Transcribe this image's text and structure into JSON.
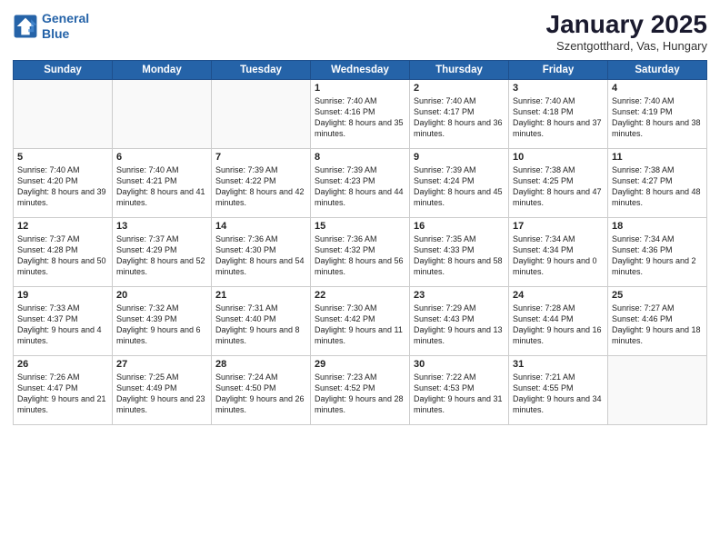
{
  "header": {
    "logo_line1": "General",
    "logo_line2": "Blue",
    "title": "January 2025",
    "subtitle": "Szentgotthard, Vas, Hungary"
  },
  "days": [
    "Sunday",
    "Monday",
    "Tuesday",
    "Wednesday",
    "Thursday",
    "Friday",
    "Saturday"
  ],
  "weeks": [
    [
      {
        "date": "",
        "content": ""
      },
      {
        "date": "",
        "content": ""
      },
      {
        "date": "",
        "content": ""
      },
      {
        "date": "1",
        "content": "Sunrise: 7:40 AM\nSunset: 4:16 PM\nDaylight: 8 hours and 35 minutes."
      },
      {
        "date": "2",
        "content": "Sunrise: 7:40 AM\nSunset: 4:17 PM\nDaylight: 8 hours and 36 minutes."
      },
      {
        "date": "3",
        "content": "Sunrise: 7:40 AM\nSunset: 4:18 PM\nDaylight: 8 hours and 37 minutes."
      },
      {
        "date": "4",
        "content": "Sunrise: 7:40 AM\nSunset: 4:19 PM\nDaylight: 8 hours and 38 minutes."
      }
    ],
    [
      {
        "date": "5",
        "content": "Sunrise: 7:40 AM\nSunset: 4:20 PM\nDaylight: 8 hours and 39 minutes."
      },
      {
        "date": "6",
        "content": "Sunrise: 7:40 AM\nSunset: 4:21 PM\nDaylight: 8 hours and 41 minutes."
      },
      {
        "date": "7",
        "content": "Sunrise: 7:39 AM\nSunset: 4:22 PM\nDaylight: 8 hours and 42 minutes."
      },
      {
        "date": "8",
        "content": "Sunrise: 7:39 AM\nSunset: 4:23 PM\nDaylight: 8 hours and 44 minutes."
      },
      {
        "date": "9",
        "content": "Sunrise: 7:39 AM\nSunset: 4:24 PM\nDaylight: 8 hours and 45 minutes."
      },
      {
        "date": "10",
        "content": "Sunrise: 7:38 AM\nSunset: 4:25 PM\nDaylight: 8 hours and 47 minutes."
      },
      {
        "date": "11",
        "content": "Sunrise: 7:38 AM\nSunset: 4:27 PM\nDaylight: 8 hours and 48 minutes."
      }
    ],
    [
      {
        "date": "12",
        "content": "Sunrise: 7:37 AM\nSunset: 4:28 PM\nDaylight: 8 hours and 50 minutes."
      },
      {
        "date": "13",
        "content": "Sunrise: 7:37 AM\nSunset: 4:29 PM\nDaylight: 8 hours and 52 minutes."
      },
      {
        "date": "14",
        "content": "Sunrise: 7:36 AM\nSunset: 4:30 PM\nDaylight: 8 hours and 54 minutes."
      },
      {
        "date": "15",
        "content": "Sunrise: 7:36 AM\nSunset: 4:32 PM\nDaylight: 8 hours and 56 minutes."
      },
      {
        "date": "16",
        "content": "Sunrise: 7:35 AM\nSunset: 4:33 PM\nDaylight: 8 hours and 58 minutes."
      },
      {
        "date": "17",
        "content": "Sunrise: 7:34 AM\nSunset: 4:34 PM\nDaylight: 9 hours and 0 minutes."
      },
      {
        "date": "18",
        "content": "Sunrise: 7:34 AM\nSunset: 4:36 PM\nDaylight: 9 hours and 2 minutes."
      }
    ],
    [
      {
        "date": "19",
        "content": "Sunrise: 7:33 AM\nSunset: 4:37 PM\nDaylight: 9 hours and 4 minutes."
      },
      {
        "date": "20",
        "content": "Sunrise: 7:32 AM\nSunset: 4:39 PM\nDaylight: 9 hours and 6 minutes."
      },
      {
        "date": "21",
        "content": "Sunrise: 7:31 AM\nSunset: 4:40 PM\nDaylight: 9 hours and 8 minutes."
      },
      {
        "date": "22",
        "content": "Sunrise: 7:30 AM\nSunset: 4:42 PM\nDaylight: 9 hours and 11 minutes."
      },
      {
        "date": "23",
        "content": "Sunrise: 7:29 AM\nSunset: 4:43 PM\nDaylight: 9 hours and 13 minutes."
      },
      {
        "date": "24",
        "content": "Sunrise: 7:28 AM\nSunset: 4:44 PM\nDaylight: 9 hours and 16 minutes."
      },
      {
        "date": "25",
        "content": "Sunrise: 7:27 AM\nSunset: 4:46 PM\nDaylight: 9 hours and 18 minutes."
      }
    ],
    [
      {
        "date": "26",
        "content": "Sunrise: 7:26 AM\nSunset: 4:47 PM\nDaylight: 9 hours and 21 minutes."
      },
      {
        "date": "27",
        "content": "Sunrise: 7:25 AM\nSunset: 4:49 PM\nDaylight: 9 hours and 23 minutes."
      },
      {
        "date": "28",
        "content": "Sunrise: 7:24 AM\nSunset: 4:50 PM\nDaylight: 9 hours and 26 minutes."
      },
      {
        "date": "29",
        "content": "Sunrise: 7:23 AM\nSunset: 4:52 PM\nDaylight: 9 hours and 28 minutes."
      },
      {
        "date": "30",
        "content": "Sunrise: 7:22 AM\nSunset: 4:53 PM\nDaylight: 9 hours and 31 minutes."
      },
      {
        "date": "31",
        "content": "Sunrise: 7:21 AM\nSunset: 4:55 PM\nDaylight: 9 hours and 34 minutes."
      },
      {
        "date": "",
        "content": ""
      }
    ]
  ]
}
